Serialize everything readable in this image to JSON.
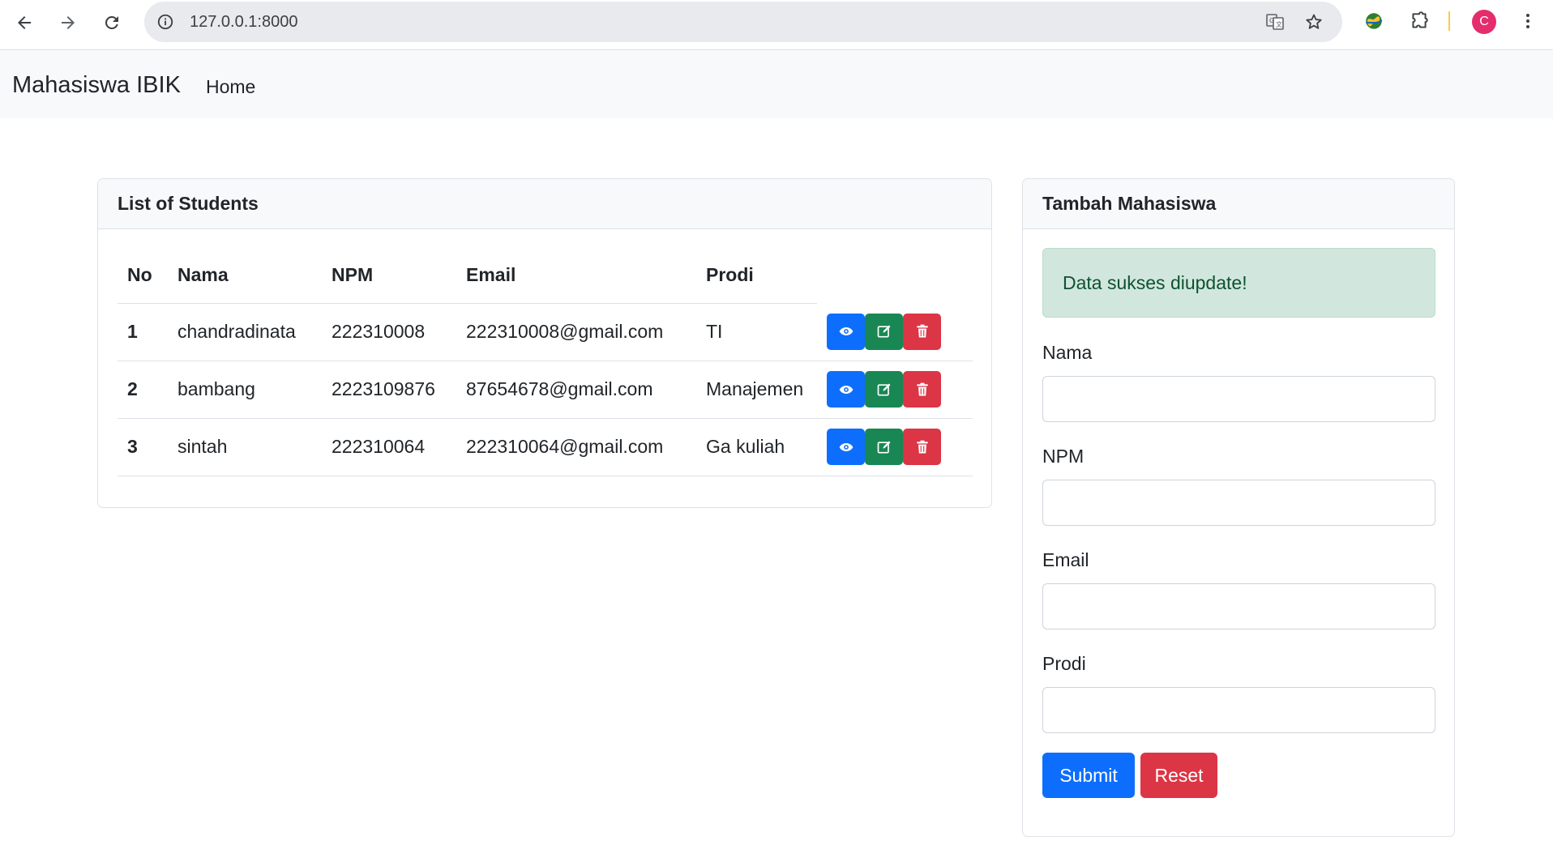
{
  "browser": {
    "url": "127.0.0.1:8000",
    "profile_initial": "C",
    "icons": {
      "back": "arrow-left-icon",
      "forward": "arrow-right-icon",
      "reload": "reload-icon",
      "site_info": "info-icon",
      "translate": "translate-icon",
      "bookmark": "star-icon",
      "extension_globe": "globe-extension-icon",
      "extensions": "puzzle-icon",
      "menu": "kebab-menu-icon"
    }
  },
  "navbar": {
    "brand": "Mahasiswa IBIK",
    "links": [
      "Home"
    ]
  },
  "list_card": {
    "title": "List of Students",
    "columns": [
      "No",
      "Nama",
      "NPM",
      "Email",
      "Prodi"
    ],
    "rows": [
      {
        "no": "1",
        "nama": "chandradinata",
        "npm": "222310008",
        "email": "222310008@gmail.com",
        "prodi": "TI"
      },
      {
        "no": "2",
        "nama": "bambang",
        "npm": "2223109876",
        "email": "87654678@gmail.com",
        "prodi": "Manajemen"
      },
      {
        "no": "3",
        "nama": "sintah",
        "npm": "222310064",
        "email": "222310064@gmail.com",
        "prodi": "Ga kuliah"
      }
    ],
    "row_actions": [
      "eye-icon",
      "edit-icon",
      "trash-icon"
    ]
  },
  "form_card": {
    "title": "Tambah Mahasiswa",
    "alert": "Data sukses diupdate!",
    "fields": [
      {
        "label": "Nama",
        "value": ""
      },
      {
        "label": "NPM",
        "value": ""
      },
      {
        "label": "Email",
        "value": ""
      },
      {
        "label": "Prodi",
        "value": ""
      }
    ],
    "submit_label": "Submit",
    "reset_label": "Reset"
  },
  "colors": {
    "primary": "#0d6efd",
    "success": "#198754",
    "danger": "#dc3545",
    "alert_bg": "#d1e7dd",
    "navbar_bg": "#f8f9fa",
    "avatar": "#e52c6c"
  }
}
